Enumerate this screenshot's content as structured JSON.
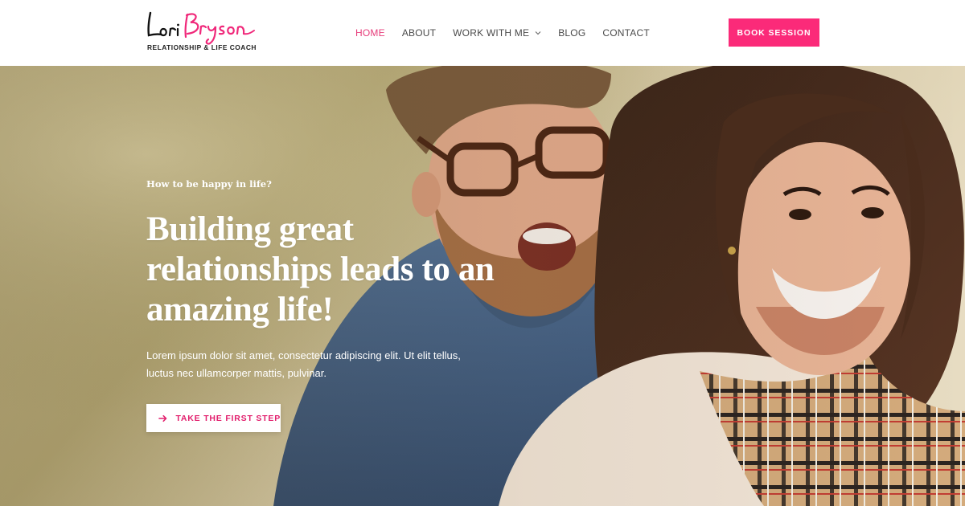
{
  "brand": {
    "name_script": "Lori Bryson",
    "tagline": "RELATIONSHIP & LIFE COACH",
    "accent_color": "#fb2a79"
  },
  "nav": {
    "items": [
      {
        "label": "HOME",
        "active": true
      },
      {
        "label": "ABOUT",
        "active": false
      },
      {
        "label": "WORK WITH ME",
        "active": false,
        "has_dropdown": true,
        "icon": "chevron-down-icon"
      },
      {
        "label": "BLOG",
        "active": false
      },
      {
        "label": "CONTACT",
        "active": false
      }
    ]
  },
  "header": {
    "cta_label": "BOOK SESSION"
  },
  "hero": {
    "eyebrow": "How to be happy in life?",
    "title": "Building great relationships leads to an amazing life!",
    "body": "Lorem ipsum dolor sit amet, consectetur adipiscing elit. Ut elit tellus, luctus nec ullamcorper mattis, pulvinar.",
    "cta_label": "TAKE THE FIRST STEP",
    "cta_icon": "arrow-right-icon",
    "image": "smiling-couple-photo"
  }
}
